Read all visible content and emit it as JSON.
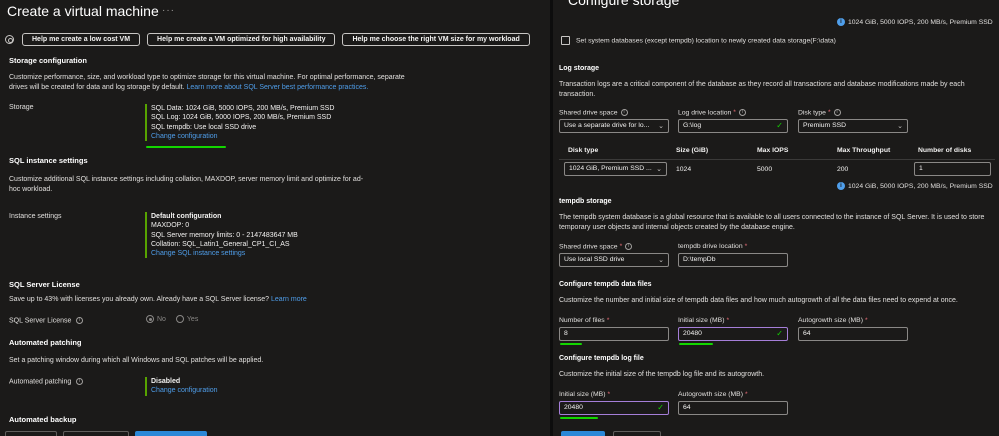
{
  "left": {
    "title": "Create a virtual machine",
    "more": "···",
    "help_buttons": [
      "Help me create a low cost VM",
      "Help me create a VM optimized for high availability",
      "Help me choose the right VM size for my workload"
    ],
    "storage_config": {
      "title": "Storage configuration",
      "desc": "Customize performance, size, and workload type to optimize storage for this virtual machine. For optimal performance, separate drives will be created for data and log storage by default.",
      "desc_link": "Learn more about SQL Server best performance practices.",
      "label": "Storage",
      "lines": [
        "SQL Data: 1024 GiB, 5000 IOPS, 200 MB/s, Premium SSD",
        "SQL Log: 1024 GiB, 5000 IOPS, 200 MB/s, Premium SSD",
        "SQL tempdb: Use local SSD drive"
      ],
      "link": "Change configuration"
    },
    "sql_instance": {
      "title": "SQL instance settings",
      "desc": "Customize additional SQL instance settings including collation, MAXDOP, server memory limit and optimize for ad-hoc workload.",
      "label": "Instance settings",
      "heading": "Default configuration",
      "lines": [
        "MAXDOP: 0",
        "SQL Server memory limits: 0 - 2147483647 MB",
        "Collation: SQL_Latin1_General_CP1_CI_AS"
      ],
      "link": "Change SQL instance settings"
    },
    "license": {
      "title": "SQL Server License",
      "desc": "Save up to 43% with licenses you already own. Already have a SQL Server license?",
      "desc_link": "Learn more",
      "label": "SQL Server License",
      "info": "i",
      "options": [
        "No",
        "Yes"
      ]
    },
    "patching": {
      "title": "Automated patching",
      "desc": "Set a patching window during which all Windows and SQL patches will be applied.",
      "label": "Automated patching",
      "info": "i",
      "value": "Disabled",
      "link": "Change configuration"
    },
    "backup": {
      "title": "Automated backup"
    }
  },
  "right": {
    "title": "Configure storage",
    "top_note": "1024 GiB, 5000 IOPS, 200 MB/s, Premium SSD",
    "info_glyph": "i",
    "system_db_checkbox": "Set system databases (except tempdb) location to newly created data storage(F:\\data)",
    "log_storage": {
      "title": "Log storage",
      "desc": "Transaction logs are a critical component of the database as they record all transactions and database modifications made by each transaction.",
      "shared_label": "Shared drive space",
      "shared_value": "Use a separate drive for lo...",
      "location_label": "Log drive location",
      "location_value": "G:\\log",
      "disktype_label": "Disk type",
      "disktype_value": "Premium SSD",
      "table_headers": [
        "Disk type",
        "Size (GiB)",
        "Max IOPS",
        "Max Throughput",
        "Number of disks"
      ],
      "table_row": {
        "disk": "1024 GiB, Premium SSD ...",
        "size": "1024",
        "iops": "5000",
        "throughput": "200",
        "count": "1"
      },
      "note": "1024 GiB, 5000 IOPS, 200 MB/s, Premium SSD"
    },
    "tempdb": {
      "title": "tempdb storage",
      "desc": "The tempdb system database is a global resource that is available to all users connected to the instance of SQL Server. It is used to store temporary user objects and internal objects created by the database engine.",
      "shared_label": "Shared drive space",
      "shared_value": "Use local SSD drive",
      "location_label": "tempdb drive location",
      "location_value": "D:\\tempDb"
    },
    "data_files": {
      "title": "Configure tempdb data files",
      "desc": "Customize the number and initial size of tempdb data files and how much autogrowth of all the data files need to expend at once.",
      "files_label": "Number of files",
      "files_value": "8",
      "size_label": "Initial size (MB)",
      "size_value": "20480",
      "growth_label": "Autogrowth size (MB)",
      "growth_value": "64"
    },
    "log_file": {
      "title": "Configure tempdb log file",
      "desc": "Customize the initial size of the tempdb log file and its autogrowth.",
      "size_label": "Initial size (MB)",
      "size_value": "20480",
      "growth_label": "Autogrowth size (MB)",
      "growth_value": "64"
    },
    "glyphs": {
      "chevron": "⌄",
      "check": "✓",
      "required": "*"
    }
  },
  "colors": {
    "accent_link": "#4f9eea",
    "success_bar": "#57a300",
    "highlight_underline": "#13d600",
    "focus_border": "#a57ed8",
    "required": "#f1707b"
  }
}
